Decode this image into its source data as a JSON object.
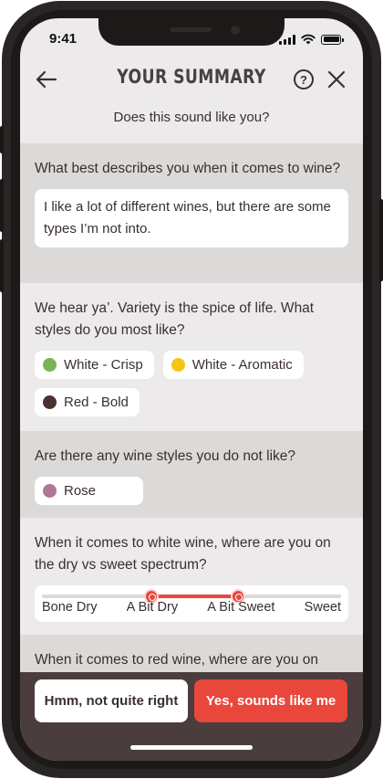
{
  "status_bar": {
    "time": "9:41"
  },
  "header": {
    "title": "YOUR SUMMARY",
    "help_label": "?"
  },
  "subtitle": "Does this sound like you?",
  "sections": [
    {
      "question": "What best describes you when it comes to wine?",
      "answer": "I like a lot of different wines, but there are some types I’m not into."
    },
    {
      "question": "We hear ya’. Variety is the spice of life. What styles do you most like?",
      "chips": [
        {
          "label": "White - Crisp",
          "color": "#7ab356"
        },
        {
          "label": "White - Aromatic",
          "color": "#f5c518"
        },
        {
          "label": "Red - Bold",
          "color": "#4b3232"
        }
      ]
    },
    {
      "question": "Are there any wine styles you do not like?",
      "chips": [
        {
          "label": "Rose",
          "color": "#b07896"
        }
      ]
    },
    {
      "question": "When it comes to white wine, where are you on the dry vs sweet spectrum?",
      "slider": {
        "ticks": [
          "Bone Dry",
          "A Bit Dry",
          "A Bit Sweet",
          "Sweet"
        ],
        "selected_range": [
          "A Bit Dry",
          "A Bit Sweet"
        ]
      }
    },
    {
      "question": "When it comes to red wine, where are you on"
    }
  ],
  "actions": {
    "secondary_label": "Hmm, not quite right",
    "primary_label": "Yes, sounds like me"
  },
  "colors": {
    "accent": "#e9463c",
    "bottom_bar": "#4a3d3d",
    "section_dark": "#dcdad9",
    "section_light": "#eceaea"
  }
}
